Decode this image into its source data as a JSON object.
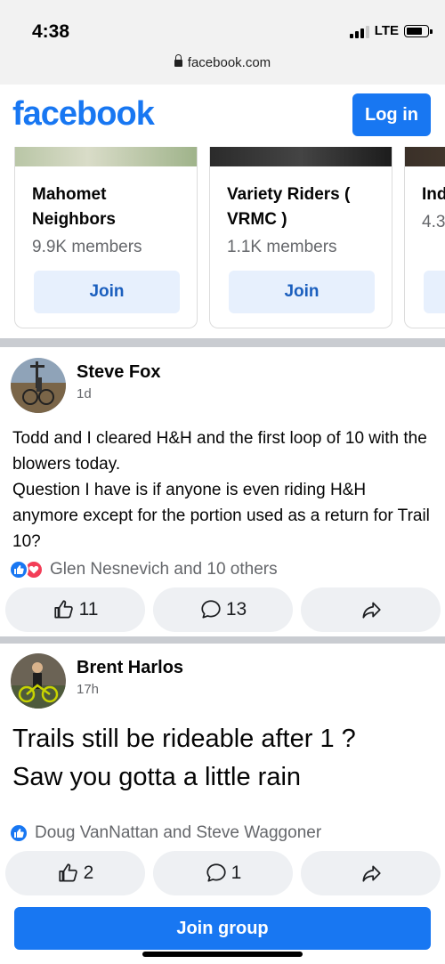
{
  "status_bar": {
    "time": "4:38",
    "network": "LTE",
    "url": "facebook.com"
  },
  "header": {
    "logo": "facebook",
    "login_label": "Log in"
  },
  "groups": [
    {
      "name": "Mahomet Neighbors",
      "members": "9.9K members",
      "join_label": "Join"
    },
    {
      "name": "Variety Riders ( VRMC )",
      "members": "1.1K members",
      "join_label": "Join"
    },
    {
      "name": "Ind",
      "members": "4.3",
      "join_label": ""
    }
  ],
  "posts": [
    {
      "author": "Steve Fox",
      "time": "1d",
      "text": "Todd and I cleared H&H and the first loop of 10 with the blowers today.\nQuestion I have is if anyone is even riding H&H anymore except for the portion used as a return for Trail 10?",
      "reactions": "Glen Nesnevich and 10 others",
      "like_count": "11",
      "comment_count": "13"
    },
    {
      "author": "Brent Harlos",
      "time": "17h",
      "text": "Trails still be rideable after 1 ? Saw you gotta a little rain",
      "reactions": "Doug VanNattan and Steve Waggoner",
      "like_count": "2",
      "comment_count": "1"
    }
  ],
  "footer": {
    "join_group_label": "Join group"
  },
  "colors": {
    "brand": "#1877f2",
    "join_bg": "#e7f0fd",
    "love": "#f33e58",
    "separator": "#c9ccd1"
  },
  "icons": [
    "lock-icon",
    "signal-icon",
    "battery-icon",
    "like-icon",
    "love-icon",
    "thumbs-up-icon",
    "comment-icon",
    "share-icon"
  ]
}
